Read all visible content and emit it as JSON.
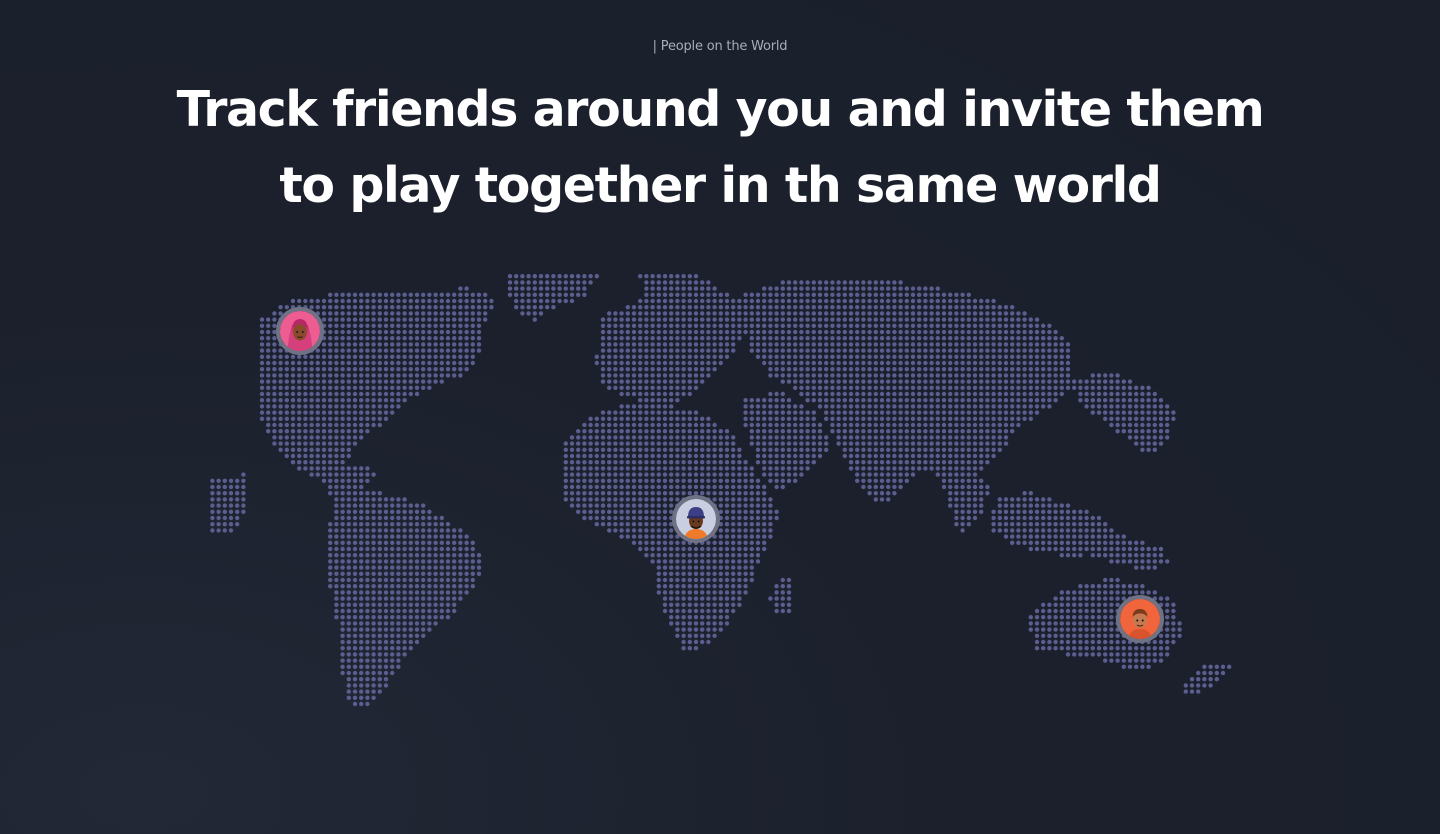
{
  "section": {
    "eyebrow": "| People on the World",
    "title_line1": "Track friends around you and invite them",
    "title_line2": "to play together in th same world"
  },
  "map": {
    "dot_color": "#5b5e8e",
    "pins": [
      {
        "name": "avatar-pin-north-america",
        "bg": "#ee5d92",
        "avatar": "woman-in-hijab-avatar-icon"
      },
      {
        "name": "avatar-pin-africa",
        "bg": "#c9cfe0",
        "avatar": "man-with-cap-avatar-icon"
      },
      {
        "name": "avatar-pin-australia",
        "bg": "#f0653c",
        "avatar": "man-avatar-icon"
      }
    ]
  },
  "colors": {
    "background": "#1b202c",
    "headline": "#ffffff",
    "eyebrow": "#a8adbb",
    "pin_border": "#6e7284"
  }
}
